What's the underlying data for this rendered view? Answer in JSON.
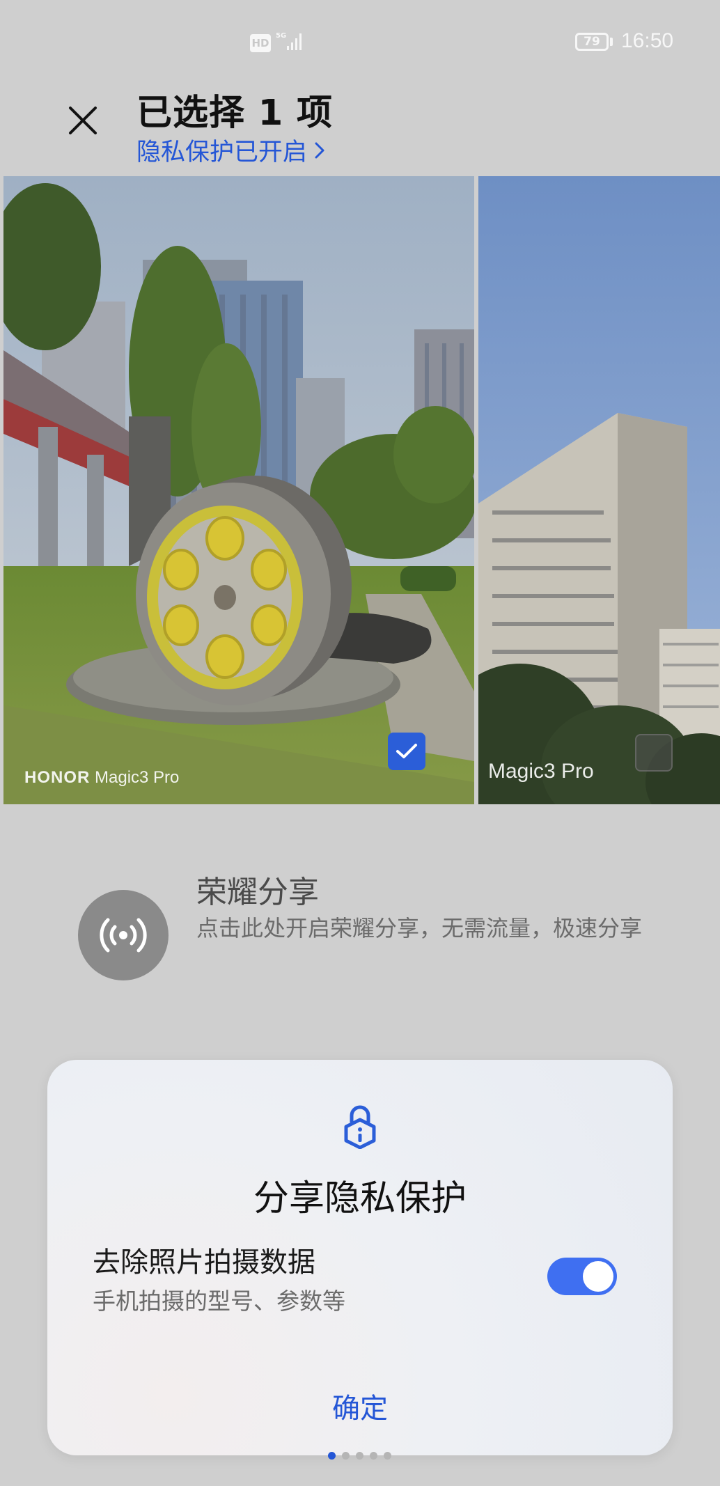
{
  "status_bar": {
    "hd": "HD",
    "network": "5G",
    "battery": "79",
    "time": "16:50"
  },
  "header": {
    "title": "已选择 1 项",
    "privacy_link": "隐私保护已开启"
  },
  "photos": [
    {
      "caption_brand": "HONOR",
      "caption_model": "Magic3 Pro",
      "selected": true
    },
    {
      "caption_model": "Magic3 Pro",
      "selected": false
    }
  ],
  "honor_share": {
    "title": "荣耀分享",
    "description": "点击此处开启荣耀分享，无需流量，极速分享"
  },
  "privacy_dialog": {
    "title": "分享隐私保护",
    "option_title": "去除照片拍摄数据",
    "option_desc": "手机拍摄的型号、参数等",
    "option_enabled": true,
    "confirm_label": "确定"
  },
  "pager": {
    "count": 5,
    "active": 0
  },
  "colors": {
    "accent": "#2456d6",
    "toggle_on": "#3f6ff1",
    "background": "#cfcfcf"
  },
  "icons": [
    "close-icon",
    "chevron-right-icon",
    "checkmark-icon",
    "wireless-share-icon",
    "privacy-lock-icon"
  ]
}
